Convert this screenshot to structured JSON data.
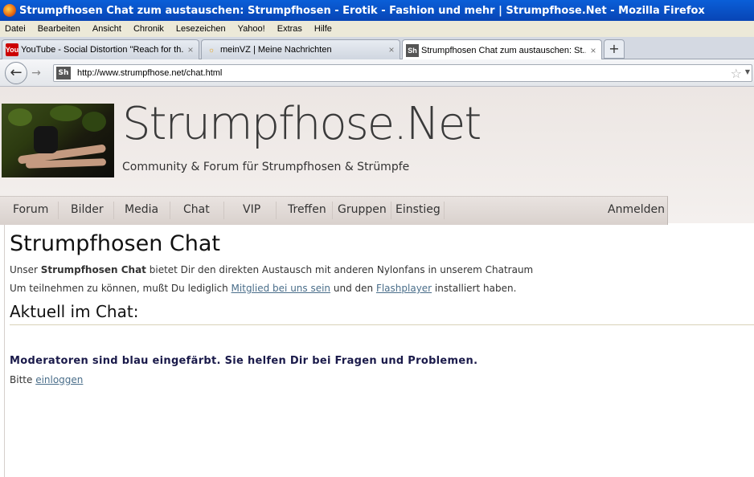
{
  "window": {
    "title": "Strumpfhosen Chat zum austauschen: Strumpfhosen - Erotik - Fashion und mehr | Strumpfhose.Net - Mozilla Firefox"
  },
  "menubar": {
    "items": [
      "Datei",
      "Bearbeiten",
      "Ansicht",
      "Chronik",
      "Lesezeichen",
      "Yahoo!",
      "Extras",
      "Hilfe"
    ]
  },
  "tabs": [
    {
      "icon": "youtube-icon",
      "icon_text": "You",
      "title": "YouTube - Social Distortion \"Reach for th...",
      "close": "×"
    },
    {
      "icon": "meinvz-icon",
      "icon_text": "☼",
      "title": "meinVZ | Meine Nachrichten",
      "close": "×"
    },
    {
      "icon": "strumpfhose-icon",
      "icon_text": "Sh",
      "title": "Strumpfhosen Chat zum austauschen: St...",
      "close": "×"
    }
  ],
  "newtab_label": "+",
  "toolbar": {
    "back_glyph": "←",
    "forward_glyph": "→",
    "favicon_text": "Sh",
    "url": "http://www.strumpfhose.net/chat.html",
    "star_glyph": "☆",
    "dropdown_glyph": "▼"
  },
  "site": {
    "title": "Strumpfhose.Net",
    "subtitle": "Community & Forum für Strumpfhosen & Strümpfe"
  },
  "nav": {
    "items": [
      "Forum",
      "Bilder",
      "Media",
      "Chat",
      "VIP",
      "Treffen",
      "Gruppen",
      "Einstieg"
    ],
    "login": "Anmelden"
  },
  "content": {
    "heading": "Strumpfhosen Chat",
    "line1_prefix": "Unser ",
    "line1_bold": "Strumpfhosen Chat",
    "line1_suffix": " bietet Dir den direkten Austausch mit anderen Nylonfans in unserem Chatraum",
    "line2_prefix": "Um teilnehmen zu können, mußt Du lediglich ",
    "line2_link1": "Mitglied bei uns sein",
    "line2_mid": " und den ",
    "line2_link2": "Flashplayer",
    "line2_suffix": " installiert haben.",
    "current_heading": "Aktuell im Chat:",
    "moderators_note": "Moderatoren sind blau eingefärbt. Sie helfen Dir bei Fragen und Problemen.",
    "login_prefix": "Bitte ",
    "login_link": "einloggen"
  }
}
